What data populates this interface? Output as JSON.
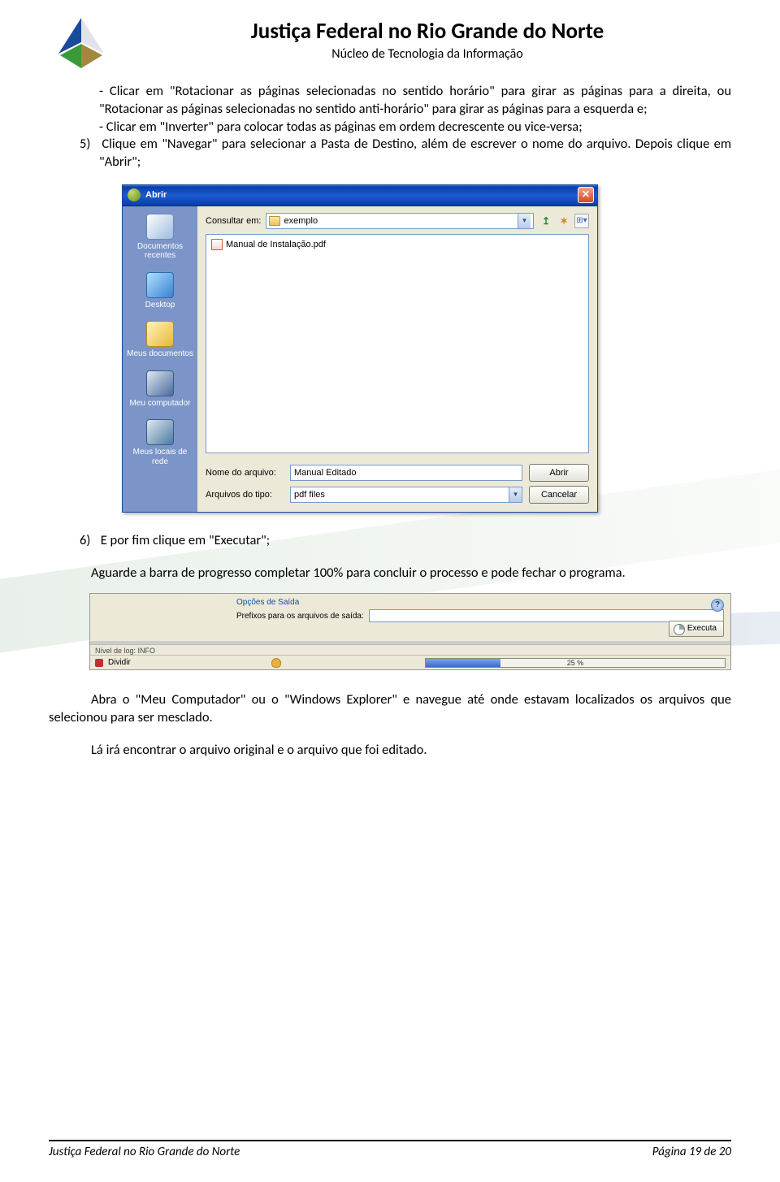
{
  "header": {
    "title": "Justiça Federal no Rio Grande do Norte",
    "subtitle": "Núcleo de Tecnologia da Informação"
  },
  "body": {
    "bullet1": "- Clicar em \"Rotacionar as páginas selecionadas no sentido horário\" para girar as páginas para a direita, ou \"Rotacionar as páginas selecionadas no sentido anti-horário\" para girar as páginas para a esquerda e;",
    "bullet2": "- Clicar em \"Inverter\" para colocar todas as páginas em ordem decrescente ou vice-versa;",
    "step5_num": "5)",
    "step5": "Clique em \"Navegar\" para selecionar a Pasta de Destino, além de escrever o nome do arquivo. Depois clique em \"Abrir\";",
    "step6_num": "6)",
    "step6": "E por fim clique em \"Executar\";",
    "para_progress": "Aguarde a barra de progresso completar 100% para concluir o processo e pode fechar o programa.",
    "para_explorer": "Abra o \"Meu Computador\" ou o \"Windows Explorer\" e navegue até onde estavam localizados os arquivos que selecionou para ser mesclado.",
    "para_final": "Lá irá encontrar o arquivo original e o arquivo que foi editado."
  },
  "dialog": {
    "title": "Abrir",
    "lookin_label": "Consultar em:",
    "lookin_value": "exemplo",
    "file_item": "Manual de Instalação.pdf",
    "filename_label": "Nome do arquivo:",
    "filename_value": "Manual Editado",
    "filetype_label": "Arquivos do tipo:",
    "filetype_value": "pdf files",
    "btn_open": "Abrir",
    "btn_cancel": "Cancelar",
    "places": {
      "recent": "Documentos recentes",
      "desktop": "Desktop",
      "mydocs": "Meus documentos",
      "mycomp": "Meu computador",
      "mynet": "Meus locais de rede"
    }
  },
  "progress": {
    "group_label": "Opções de Saída",
    "prefix_label": "Prefixos para os arquivos de saída:",
    "execute_btn": "Executa",
    "log_label": "Nível de log: INFO",
    "task": "Dividir",
    "percent": "25 %"
  },
  "footer": {
    "left": "Justiça Federal no Rio Grande do Norte",
    "right": "Página 19 de 20"
  }
}
